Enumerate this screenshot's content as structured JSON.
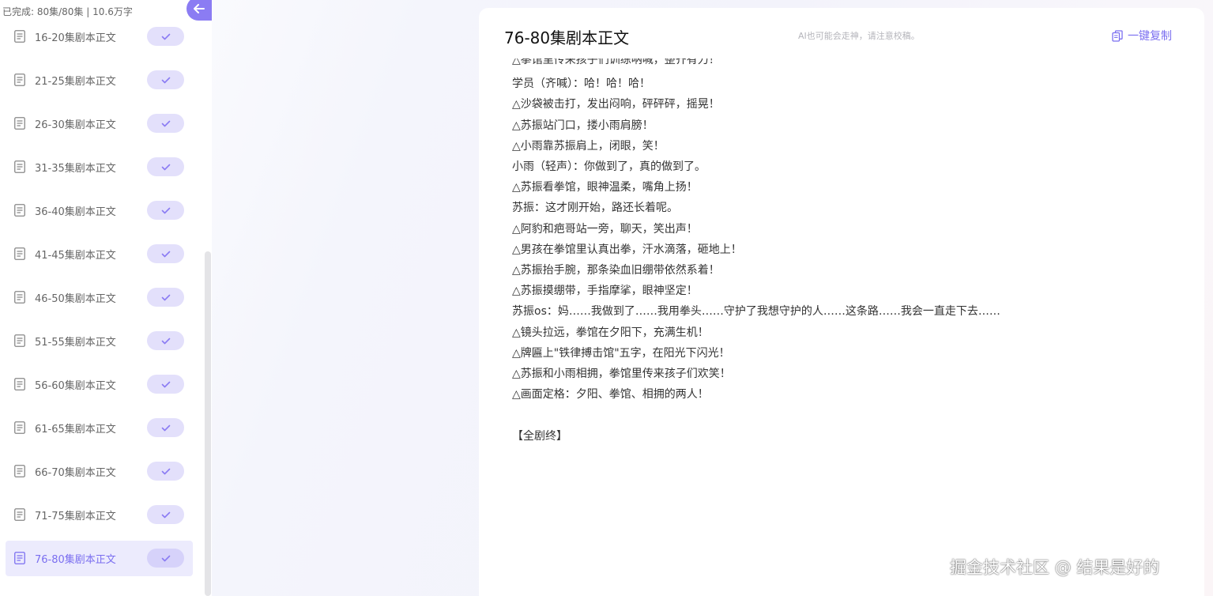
{
  "sidebar": {
    "summary": "已完成: 80集/80集 | 10.6万字",
    "collapse_icon": "arrow-left-icon",
    "accent_color": "#8b7cf3",
    "items": [
      {
        "label": "16-20集剧本正文",
        "done": true,
        "active": false
      },
      {
        "label": "21-25集剧本正文",
        "done": true,
        "active": false
      },
      {
        "label": "26-30集剧本正文",
        "done": true,
        "active": false
      },
      {
        "label": "31-35集剧本正文",
        "done": true,
        "active": false
      },
      {
        "label": "36-40集剧本正文",
        "done": true,
        "active": false
      },
      {
        "label": "41-45集剧本正文",
        "done": true,
        "active": false
      },
      {
        "label": "46-50集剧本正文",
        "done": true,
        "active": false
      },
      {
        "label": "51-55集剧本正文",
        "done": true,
        "active": false
      },
      {
        "label": "56-60集剧本正文",
        "done": true,
        "active": false
      },
      {
        "label": "61-65集剧本正文",
        "done": true,
        "active": false
      },
      {
        "label": "66-70集剧本正文",
        "done": true,
        "active": false
      },
      {
        "label": "71-75集剧本正文",
        "done": true,
        "active": false
      },
      {
        "label": "76-80集剧本正文",
        "done": true,
        "active": true
      }
    ]
  },
  "content": {
    "title": "76-80集剧本正文",
    "ai_note": "AI也可能会走神，请注意校稿。",
    "copy_label": "一键复制",
    "copy_icon": "copy-icon",
    "lines": [
      "△拳馆里传来孩子们训练呐喊，整齐有力！",
      "学员（齐喊）：哈！哈！哈！",
      "△沙袋被击打，发出闷响，砰砰砰，摇晃！",
      "△苏振站门口，搂小雨肩膀！",
      "△小雨靠苏振肩上，闭眼，笑！",
      "小雨（轻声）：你做到了，真的做到了。",
      "△苏振看拳馆，眼神温柔，嘴角上扬！",
      "苏振：这才刚开始，路还长着呢。",
      "△阿豹和疤哥站一旁，聊天，笑出声！",
      "△男孩在拳馆里认真出拳，汗水滴落，砸地上！",
      "△苏振抬手腕，那条染血旧绷带依然系着！",
      "△苏振摸绷带，手指摩挲，眼神坚定！",
      "苏振os：妈……我做到了……我用拳头……守护了我想守护的人……这条路……我会一直走下去……",
      "△镜头拉远，拳馆在夕阳下，充满生机！",
      "△牌匾上\"铁律搏击馆\"五字，在阳光下闪光！",
      "△苏振和小雨相拥，拳馆里传来孩子们欢笑！",
      "△画面定格：夕阳、拳馆、相拥的两人！",
      "",
      "【全剧终】"
    ]
  },
  "watermark": "掘金技术社区 @ 结果是好的"
}
